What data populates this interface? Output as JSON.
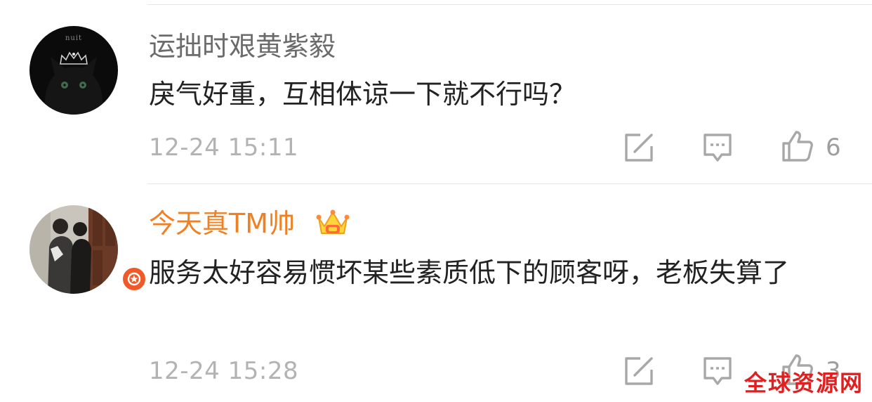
{
  "comments": [
    {
      "username": "运拙时艰黄紫毅",
      "text": "戾气好重，互相体谅一下就不行吗？",
      "timestamp": "12-24 15:11",
      "likes": "6",
      "username_color": "#6b6b6b",
      "avatar_icon": "black-cat-crown-avatar",
      "avatar_text": "nuit"
    },
    {
      "username": "今天真TM帅",
      "text": "服务太好容易惯坏某些素质低下的顾客呀，老板失算了",
      "timestamp": "12-24 15:28",
      "likes": "3",
      "username_color": "#f08024",
      "avatar_icon": "couple-photo-avatar",
      "badges": [
        "vip-crown-icon",
        "verified-star-icon"
      ]
    }
  ],
  "actions": [
    "forward-icon",
    "comment-icon",
    "like-icon"
  ],
  "watermark": "全球资源网",
  "colors": {
    "accent_orange": "#f08024",
    "verified_red": "#f05a2a",
    "watermark_red": "#e02020",
    "icon_gray": "#a8a8a8"
  }
}
